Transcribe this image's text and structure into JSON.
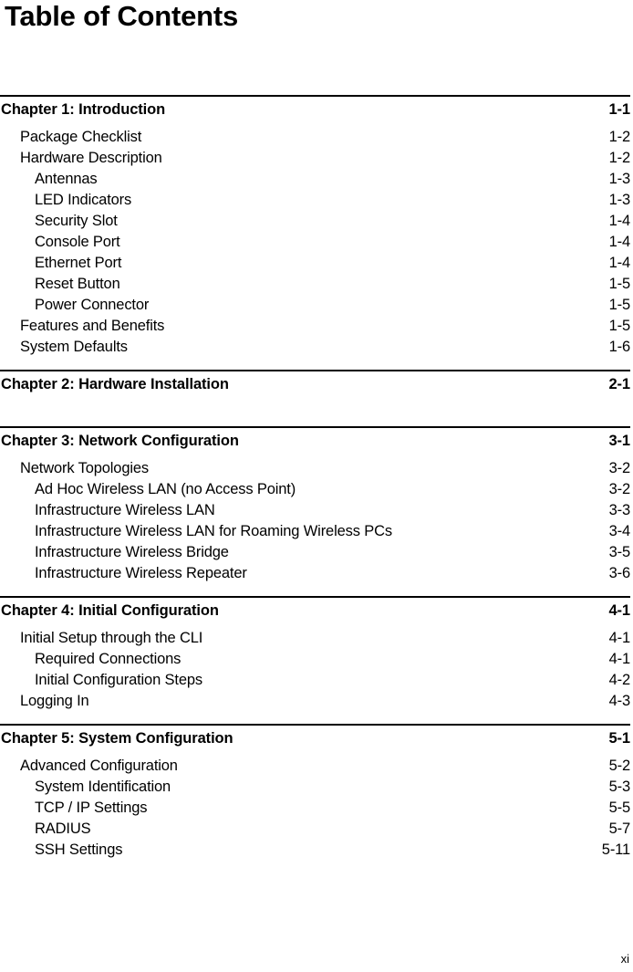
{
  "document": {
    "title": "Table of Contents",
    "folio": "xi"
  },
  "toc": {
    "chapters": [
      {
        "heading": "Chapter 1: Introduction",
        "page": "1-1",
        "entries": [
          {
            "label": "Package Checklist",
            "page": "1-2",
            "level": 1
          },
          {
            "label": "Hardware Description",
            "page": "1-2",
            "level": 1
          },
          {
            "label": "Antennas",
            "page": "1-3",
            "level": 2
          },
          {
            "label": "LED Indicators",
            "page": "1-3",
            "level": 2
          },
          {
            "label": "Security Slot",
            "page": "1-4",
            "level": 2
          },
          {
            "label": "Console Port",
            "page": "1-4",
            "level": 2
          },
          {
            "label": "Ethernet Port",
            "page": "1-4",
            "level": 2
          },
          {
            "label": "Reset Button",
            "page": "1-5",
            "level": 2
          },
          {
            "label": "Power Connector",
            "page": "1-5",
            "level": 2
          },
          {
            "label": "Features and Benefits",
            "page": "1-5",
            "level": 1
          },
          {
            "label": "System Defaults",
            "page": "1-6",
            "level": 1
          }
        ]
      },
      {
        "heading": "Chapter 2: Hardware Installation",
        "page": "2-1",
        "entries": []
      },
      {
        "heading": "Chapter 3: Network Configuration",
        "page": "3-1",
        "entries": [
          {
            "label": "Network Topologies",
            "page": "3-2",
            "level": 1
          },
          {
            "label": "Ad Hoc Wireless LAN (no Access Point)",
            "page": "3-2",
            "level": 2
          },
          {
            "label": "Infrastructure Wireless LAN",
            "page": "3-3",
            "level": 2
          },
          {
            "label": "Infrastructure Wireless LAN for Roaming Wireless PCs",
            "page": "3-4",
            "level": 2
          },
          {
            "label": "Infrastructure Wireless Bridge",
            "page": "3-5",
            "level": 2
          },
          {
            "label": "Infrastructure Wireless Repeater",
            "page": "3-6",
            "level": 2
          }
        ]
      },
      {
        "heading": "Chapter 4: Initial Configuration",
        "page": "4-1",
        "entries": [
          {
            "label": "Initial Setup through the CLI",
            "page": "4-1",
            "level": 1
          },
          {
            "label": "Required Connections",
            "page": "4-1",
            "level": 2
          },
          {
            "label": "Initial Configuration Steps",
            "page": "4-2",
            "level": 2
          },
          {
            "label": "Logging In",
            "page": "4-3",
            "level": 1
          }
        ]
      },
      {
        "heading": "Chapter 5: System Configuration",
        "page": "5-1",
        "entries": [
          {
            "label": "Advanced Configuration",
            "page": "5-2",
            "level": 1
          },
          {
            "label": "System Identification",
            "page": "5-3",
            "level": 2
          },
          {
            "label": "TCP / IP Settings",
            "page": "5-5",
            "level": 2
          },
          {
            "label": "RADIUS",
            "page": "5-7",
            "level": 2
          },
          {
            "label": "SSH Settings",
            "page": "5-11",
            "level": 2
          }
        ]
      }
    ]
  }
}
